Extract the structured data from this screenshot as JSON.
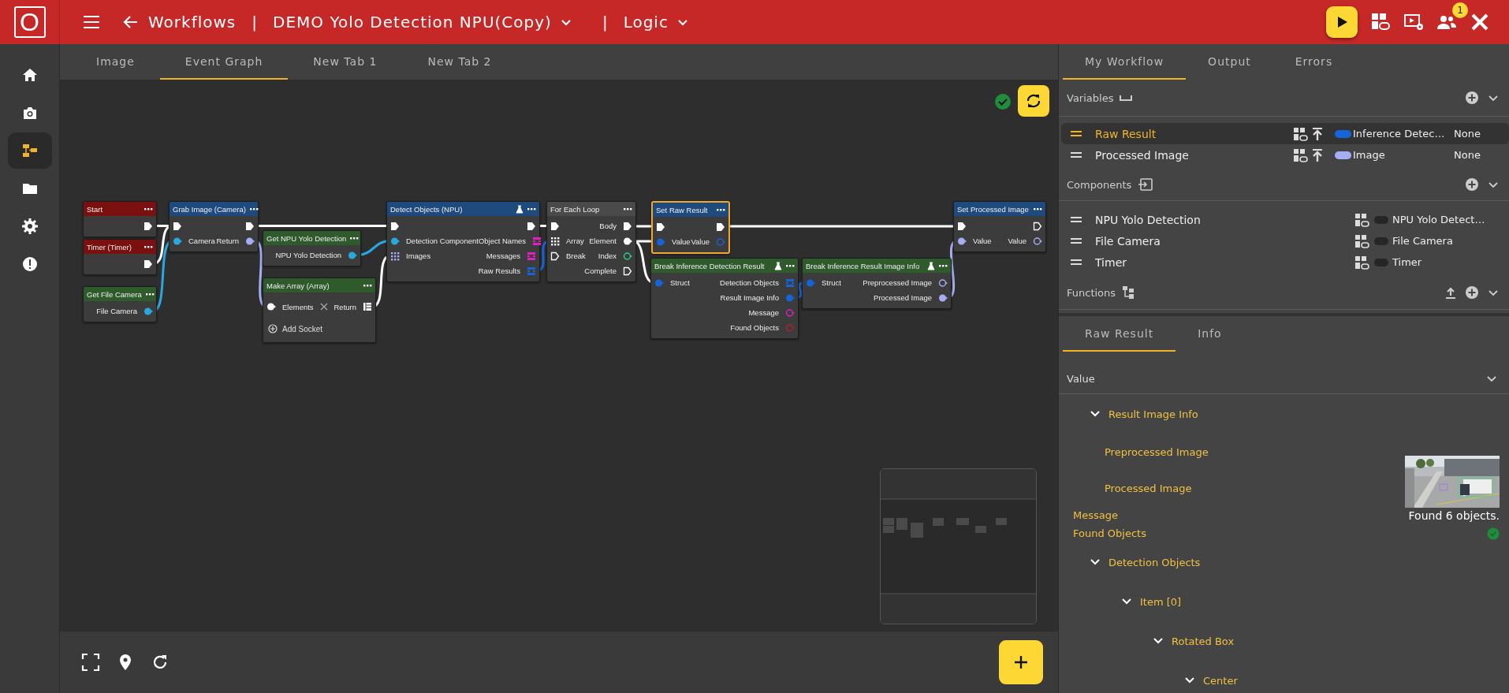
{
  "top_bar": {
    "logo": "O",
    "back_label": "Workflows",
    "separator": "|",
    "workflow_title": "DEMO Yolo Detection NPU(Copy)",
    "separator_2": "|",
    "mode": "Logic",
    "notification_count": "1"
  },
  "sidebar": {
    "items": [
      {
        "kind": "home",
        "selected": false
      },
      {
        "kind": "camera",
        "selected": false
      },
      {
        "kind": "workflow",
        "selected": true
      },
      {
        "kind": "folder",
        "selected": false
      },
      {
        "kind": "settings",
        "selected": false
      },
      {
        "kind": "alert",
        "selected": false
      }
    ]
  },
  "graph_tabs": [
    {
      "label": "Image",
      "selected": false
    },
    {
      "label": "Event Graph",
      "selected": true
    },
    {
      "label": "New Tab 1",
      "selected": false
    },
    {
      "label": "New Tab 2",
      "selected": false
    }
  ],
  "canvas": {
    "valid": true,
    "nodes": [
      {
        "title": "Start",
        "kind": "event",
        "selected": false,
        "flask": false,
        "outputs": [
          {
            "kind": "exec"
          }
        ]
      },
      {
        "title": "Timer (Timer)",
        "kind": "event",
        "selected": false,
        "flask": false,
        "outputs": [
          {
            "kind": "exec"
          }
        ]
      },
      {
        "title": "Get File Camera",
        "kind": "pure",
        "selected": false,
        "flask": false,
        "outputs": [
          {
            "kind": "data",
            "label": "File Camera",
            "color": "#29a8e0"
          }
        ]
      },
      {
        "title": "Grab Image (Camera)",
        "kind": "function",
        "selected": false,
        "flask": false,
        "inputs": [
          {
            "kind": "exec"
          },
          {
            "kind": "data",
            "label": "Camera",
            "color": "#29a8e0"
          }
        ],
        "outputs": [
          {
            "kind": "exec"
          },
          {
            "kind": "data",
            "label": "Return",
            "color": "#a5adf5"
          }
        ]
      },
      {
        "title": "Get NPU Yolo Detection",
        "kind": "pure",
        "selected": false,
        "flask": false,
        "outputs": [
          {
            "kind": "data",
            "label": "NPU Yolo Detection",
            "color": "#29a8e0"
          }
        ]
      },
      {
        "title": "Make Array (Array)",
        "kind": "pure",
        "selected": false,
        "flask": false,
        "add_socket": "Add Socket",
        "inputs": [
          {
            "kind": "removable",
            "label": "Elements",
            "color": "#ffffff"
          }
        ],
        "outputs": [
          {
            "kind": "array",
            "label": "Return",
            "color": "#ffffff"
          }
        ]
      },
      {
        "title": "Detect Objects (NPU)",
        "kind": "function",
        "selected": false,
        "flask": true,
        "inputs": [
          {
            "kind": "exec"
          },
          {
            "kind": "data",
            "label": "Detection Component",
            "color": "#29a8e0"
          },
          {
            "kind": "grid",
            "label": "Images",
            "color": "#a5adf5"
          }
        ],
        "outputs": [
          {
            "kind": "exec"
          },
          {
            "kind": "list",
            "label": "Object Names",
            "color": "#e020c0"
          },
          {
            "kind": "list",
            "label": "Messages",
            "color": "#e020c0"
          },
          {
            "kind": "list",
            "label": "Raw Results",
            "color": "#1565d8"
          }
        ]
      },
      {
        "title": "For Each Loop",
        "kind": "flow",
        "selected": false,
        "flask": false,
        "inputs": [
          {
            "kind": "exec"
          },
          {
            "kind": "grid",
            "label": "Array",
            "color": "#ffffff"
          },
          {
            "kind": "exec-hollow",
            "label": "Break"
          }
        ],
        "outputs": [
          {
            "kind": "exec",
            "label": "Body"
          },
          {
            "kind": "data",
            "label": "Element",
            "color": "#ffffff"
          },
          {
            "kind": "ring",
            "label": "Index",
            "color": "#2ecc8f"
          },
          {
            "kind": "exec-hollow",
            "label": "Complete"
          }
        ]
      },
      {
        "title": "Set Raw Result",
        "kind": "function",
        "selected": true,
        "flask": false,
        "inputs": [
          {
            "kind": "exec"
          },
          {
            "kind": "data",
            "label": "Value",
            "color": "#1565d8"
          }
        ],
        "outputs": [
          {
            "kind": "exec"
          },
          {
            "kind": "ring",
            "label": "Value",
            "color": "#1565d8"
          }
        ]
      },
      {
        "title": "Break Inference Detection Result",
        "kind": "pure",
        "selected": false,
        "flask": true,
        "inputs": [
          {
            "kind": "data",
            "label": "Struct",
            "color": "#1565d8"
          }
        ],
        "outputs": [
          {
            "kind": "list",
            "label": "Detection Objects",
            "color": "#1565d8"
          },
          {
            "kind": "data",
            "label": "Result Image Info",
            "color": "#1565d8"
          },
          {
            "kind": "ring",
            "label": "Message",
            "color": "#e020c0"
          },
          {
            "kind": "ring",
            "label": "Found Objects",
            "color": "#b02030"
          }
        ]
      },
      {
        "title": "Break Inference Result Image Info",
        "kind": "pure",
        "selected": false,
        "flask": true,
        "inputs": [
          {
            "kind": "data",
            "label": "Struct",
            "color": "#1565d8"
          }
        ],
        "outputs": [
          {
            "kind": "ring",
            "label": "Preprocessed Image",
            "color": "#a5adf5"
          },
          {
            "kind": "data",
            "label": "Processed Image",
            "color": "#a5adf5"
          }
        ]
      },
      {
        "title": "Set Processed Image",
        "kind": "function",
        "selected": false,
        "flask": false,
        "inputs": [
          {
            "kind": "exec"
          },
          {
            "kind": "data",
            "label": "Value",
            "color": "#a5adf5"
          }
        ],
        "outputs": [
          {
            "kind": "exec-hollow"
          },
          {
            "kind": "ring",
            "label": "Value",
            "color": "#a5adf5"
          }
        ]
      }
    ]
  },
  "right_panel": {
    "tabs": [
      {
        "label": "My Workflow",
        "selected": true
      },
      {
        "label": "Output",
        "selected": false
      },
      {
        "label": "Errors",
        "selected": false
      }
    ],
    "variables": {
      "title": "Variables",
      "items": [
        {
          "name": "Raw Result",
          "selected": true,
          "color": "#1565d8",
          "type": "Inference Detec…",
          "value": "None"
        },
        {
          "name": "Processed Image",
          "selected": false,
          "color": "#a5adf5",
          "type": "Image",
          "value": "None"
        }
      ]
    },
    "components": {
      "title": "Components",
      "items": [
        {
          "name": "NPU Yolo Detection",
          "color": "#262626",
          "type": "NPU Yolo Detect…"
        },
        {
          "name": "File Camera",
          "color": "#262626",
          "type": "File Camera"
        },
        {
          "name": "Timer",
          "color": "#262626",
          "type": "Timer"
        }
      ]
    },
    "functions": {
      "title": "Functions"
    }
  },
  "detail_panel": {
    "tabs": [
      {
        "label": "Raw Result",
        "selected": true
      },
      {
        "label": "Info",
        "selected": false
      }
    ],
    "value_label": "Value",
    "tree": [
      {
        "kind": "group",
        "label": "Result Image Info",
        "expanded": true,
        "children": [
          {
            "kind": "empty",
            "label": "Preprocessed Image"
          },
          {
            "label": "Processed Image"
          }
        ]
      },
      {
        "kind": "text",
        "label": "Message",
        "value": "Found 6 objects."
      },
      {
        "kind": "check",
        "label": "Found Objects"
      },
      {
        "kind": "group",
        "label": "Detection Objects",
        "expanded": true,
        "children": [
          {
            "kind": "group",
            "label": "Item [0]",
            "expanded": true,
            "children": [
              {
                "kind": "group",
                "label": "Rotated Box",
                "expanded": true,
                "children": [
                  {
                    "kind": "group",
                    "label": "Center",
                    "expanded": true
                  }
                ]
              }
            ]
          }
        ]
      }
    ]
  }
}
